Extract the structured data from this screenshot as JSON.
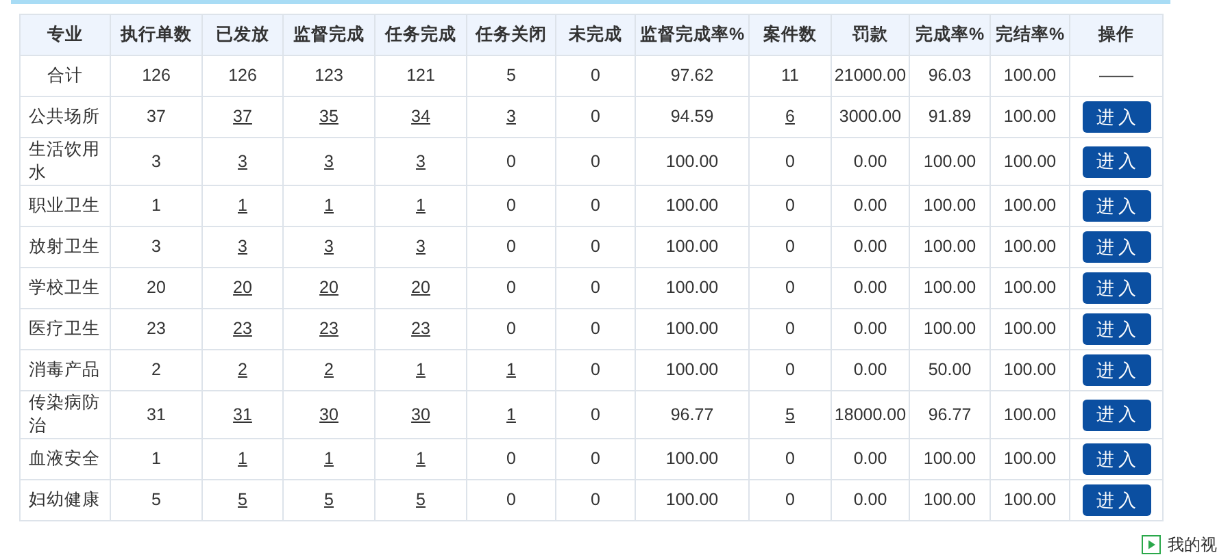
{
  "table": {
    "columns": [
      "专业",
      "执行单数",
      "已发放",
      "监督完成",
      "任务完成",
      "任务关闭",
      "未完成",
      "监督完成率%",
      "案件数",
      "罚款",
      "完成率%",
      "完结率%",
      "操作"
    ],
    "rows": [
      {
        "kind": "total",
        "cells": [
          {
            "kind": "text",
            "text": "合计"
          },
          {
            "kind": "text",
            "text": "126"
          },
          {
            "kind": "text",
            "text": "126"
          },
          {
            "kind": "text",
            "text": "123"
          },
          {
            "kind": "text",
            "text": "121"
          },
          {
            "kind": "text",
            "text": "5"
          },
          {
            "kind": "text",
            "text": "0"
          },
          {
            "kind": "text",
            "text": "97.62"
          },
          {
            "kind": "text",
            "text": "11"
          },
          {
            "kind": "text",
            "text": "21000.00"
          },
          {
            "kind": "text",
            "text": "96.03"
          },
          {
            "kind": "text",
            "text": "100.00"
          },
          {
            "kind": "text",
            "text": "——"
          }
        ]
      },
      {
        "kind": "item",
        "cells": [
          {
            "kind": "text",
            "text": "公共场所"
          },
          {
            "kind": "text",
            "text": "37"
          },
          {
            "kind": "link",
            "text": "37"
          },
          {
            "kind": "link",
            "text": "35"
          },
          {
            "kind": "link",
            "text": "34"
          },
          {
            "kind": "link",
            "text": "3"
          },
          {
            "kind": "text",
            "text": "0"
          },
          {
            "kind": "text",
            "text": "94.59"
          },
          {
            "kind": "link",
            "text": "6"
          },
          {
            "kind": "text",
            "text": "3000.00"
          },
          {
            "kind": "text",
            "text": "91.89"
          },
          {
            "kind": "text",
            "text": "100.00"
          },
          {
            "kind": "button",
            "text": "进入"
          }
        ]
      },
      {
        "kind": "item",
        "cells": [
          {
            "kind": "text",
            "text": "生活饮用水"
          },
          {
            "kind": "text",
            "text": "3"
          },
          {
            "kind": "link",
            "text": "3"
          },
          {
            "kind": "link",
            "text": "3"
          },
          {
            "kind": "link",
            "text": "3"
          },
          {
            "kind": "text",
            "text": "0"
          },
          {
            "kind": "text",
            "text": "0"
          },
          {
            "kind": "text",
            "text": "100.00"
          },
          {
            "kind": "text",
            "text": "0"
          },
          {
            "kind": "text",
            "text": "0.00"
          },
          {
            "kind": "text",
            "text": "100.00"
          },
          {
            "kind": "text",
            "text": "100.00"
          },
          {
            "kind": "button",
            "text": "进入"
          }
        ]
      },
      {
        "kind": "item",
        "cells": [
          {
            "kind": "text",
            "text": "职业卫生"
          },
          {
            "kind": "text",
            "text": "1"
          },
          {
            "kind": "link",
            "text": "1"
          },
          {
            "kind": "link",
            "text": "1"
          },
          {
            "kind": "link",
            "text": "1"
          },
          {
            "kind": "text",
            "text": "0"
          },
          {
            "kind": "text",
            "text": "0"
          },
          {
            "kind": "text",
            "text": "100.00"
          },
          {
            "kind": "text",
            "text": "0"
          },
          {
            "kind": "text",
            "text": "0.00"
          },
          {
            "kind": "text",
            "text": "100.00"
          },
          {
            "kind": "text",
            "text": "100.00"
          },
          {
            "kind": "button",
            "text": "进入"
          }
        ]
      },
      {
        "kind": "item",
        "cells": [
          {
            "kind": "text",
            "text": "放射卫生"
          },
          {
            "kind": "text",
            "text": "3"
          },
          {
            "kind": "link",
            "text": "3"
          },
          {
            "kind": "link",
            "text": "3"
          },
          {
            "kind": "link",
            "text": "3"
          },
          {
            "kind": "text",
            "text": "0"
          },
          {
            "kind": "text",
            "text": "0"
          },
          {
            "kind": "text",
            "text": "100.00"
          },
          {
            "kind": "text",
            "text": "0"
          },
          {
            "kind": "text",
            "text": "0.00"
          },
          {
            "kind": "text",
            "text": "100.00"
          },
          {
            "kind": "text",
            "text": "100.00"
          },
          {
            "kind": "button",
            "text": "进入"
          }
        ]
      },
      {
        "kind": "item",
        "cells": [
          {
            "kind": "text",
            "text": "学校卫生"
          },
          {
            "kind": "text",
            "text": "20"
          },
          {
            "kind": "link",
            "text": "20"
          },
          {
            "kind": "link",
            "text": "20"
          },
          {
            "kind": "link",
            "text": "20"
          },
          {
            "kind": "text",
            "text": "0"
          },
          {
            "kind": "text",
            "text": "0"
          },
          {
            "kind": "text",
            "text": "100.00"
          },
          {
            "kind": "text",
            "text": "0"
          },
          {
            "kind": "text",
            "text": "0.00"
          },
          {
            "kind": "text",
            "text": "100.00"
          },
          {
            "kind": "text",
            "text": "100.00"
          },
          {
            "kind": "button",
            "text": "进入"
          }
        ]
      },
      {
        "kind": "item",
        "cells": [
          {
            "kind": "text",
            "text": "医疗卫生"
          },
          {
            "kind": "text",
            "text": "23"
          },
          {
            "kind": "link",
            "text": "23"
          },
          {
            "kind": "link",
            "text": "23"
          },
          {
            "kind": "link",
            "text": "23"
          },
          {
            "kind": "text",
            "text": "0"
          },
          {
            "kind": "text",
            "text": "0"
          },
          {
            "kind": "text",
            "text": "100.00"
          },
          {
            "kind": "text",
            "text": "0"
          },
          {
            "kind": "text",
            "text": "0.00"
          },
          {
            "kind": "text",
            "text": "100.00"
          },
          {
            "kind": "text",
            "text": "100.00"
          },
          {
            "kind": "button",
            "text": "进入"
          }
        ]
      },
      {
        "kind": "item",
        "cells": [
          {
            "kind": "text",
            "text": "消毒产品"
          },
          {
            "kind": "text",
            "text": "2"
          },
          {
            "kind": "link",
            "text": "2"
          },
          {
            "kind": "link",
            "text": "2"
          },
          {
            "kind": "link",
            "text": "1"
          },
          {
            "kind": "link",
            "text": "1"
          },
          {
            "kind": "text",
            "text": "0"
          },
          {
            "kind": "text",
            "text": "100.00"
          },
          {
            "kind": "text",
            "text": "0"
          },
          {
            "kind": "text",
            "text": "0.00"
          },
          {
            "kind": "text",
            "text": "50.00"
          },
          {
            "kind": "text",
            "text": "100.00"
          },
          {
            "kind": "button",
            "text": "进入"
          }
        ]
      },
      {
        "kind": "item",
        "cells": [
          {
            "kind": "text",
            "text": "传染病防治"
          },
          {
            "kind": "text",
            "text": "31"
          },
          {
            "kind": "link",
            "text": "31"
          },
          {
            "kind": "link",
            "text": "30"
          },
          {
            "kind": "link",
            "text": "30"
          },
          {
            "kind": "link",
            "text": "1"
          },
          {
            "kind": "text",
            "text": "0"
          },
          {
            "kind": "text",
            "text": "96.77"
          },
          {
            "kind": "link",
            "text": "5"
          },
          {
            "kind": "text",
            "text": "18000.00"
          },
          {
            "kind": "text",
            "text": "96.77"
          },
          {
            "kind": "text",
            "text": "100.00"
          },
          {
            "kind": "button",
            "text": "进入"
          }
        ]
      },
      {
        "kind": "item",
        "cells": [
          {
            "kind": "text",
            "text": "血液安全"
          },
          {
            "kind": "text",
            "text": "1"
          },
          {
            "kind": "link",
            "text": "1"
          },
          {
            "kind": "link",
            "text": "1"
          },
          {
            "kind": "link",
            "text": "1"
          },
          {
            "kind": "text",
            "text": "0"
          },
          {
            "kind": "text",
            "text": "0"
          },
          {
            "kind": "text",
            "text": "100.00"
          },
          {
            "kind": "text",
            "text": "0"
          },
          {
            "kind": "text",
            "text": "0.00"
          },
          {
            "kind": "text",
            "text": "100.00"
          },
          {
            "kind": "text",
            "text": "100.00"
          },
          {
            "kind": "button",
            "text": "进入"
          }
        ]
      },
      {
        "kind": "item",
        "cells": [
          {
            "kind": "text",
            "text": "妇幼健康"
          },
          {
            "kind": "text",
            "text": "5"
          },
          {
            "kind": "link",
            "text": "5"
          },
          {
            "kind": "link",
            "text": "5"
          },
          {
            "kind": "link",
            "text": "5"
          },
          {
            "kind": "text",
            "text": "0"
          },
          {
            "kind": "text",
            "text": "0"
          },
          {
            "kind": "text",
            "text": "100.00"
          },
          {
            "kind": "text",
            "text": "0"
          },
          {
            "kind": "text",
            "text": "0.00"
          },
          {
            "kind": "text",
            "text": "100.00"
          },
          {
            "kind": "text",
            "text": "100.00"
          },
          {
            "kind": "button",
            "text": "进入"
          }
        ]
      }
    ]
  },
  "status_bar": {
    "label": "我的视"
  }
}
